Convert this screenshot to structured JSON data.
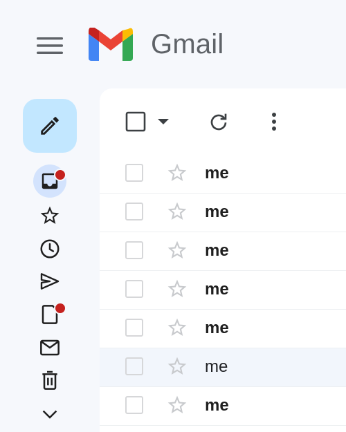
{
  "header": {
    "app_name": "Gmail",
    "menu_icon": "hamburger-menu-icon",
    "logo_icon": "gmail-m-logo-icon"
  },
  "rail": {
    "compose_icon": "pencil-icon",
    "items": [
      {
        "name": "inbox",
        "icon": "inbox-icon",
        "active": true,
        "has_dot": true
      },
      {
        "name": "starred",
        "icon": "star-outline-icon",
        "active": false,
        "has_dot": false
      },
      {
        "name": "snoozed",
        "icon": "clock-icon",
        "active": false,
        "has_dot": false
      },
      {
        "name": "sent",
        "icon": "send-icon",
        "active": false,
        "has_dot": false
      },
      {
        "name": "drafts",
        "icon": "draft-icon",
        "active": false,
        "has_dot": true
      },
      {
        "name": "all-mail",
        "icon": "envelope-icon",
        "active": false,
        "has_dot": false
      },
      {
        "name": "trash",
        "icon": "trash-icon",
        "active": false,
        "has_dot": false
      },
      {
        "name": "more",
        "icon": "chevron-down-icon",
        "active": false,
        "has_dot": false
      }
    ]
  },
  "toolbar": {
    "select_icon": "checkbox-icon",
    "select_menu_icon": "caret-down-icon",
    "refresh_icon": "refresh-icon",
    "more_icon": "vertical-dots-icon"
  },
  "mail_rows": [
    {
      "sender": "me",
      "unread": true
    },
    {
      "sender": "me",
      "unread": true
    },
    {
      "sender": "me",
      "unread": true
    },
    {
      "sender": "me",
      "unread": true
    },
    {
      "sender": "me",
      "unread": true
    },
    {
      "sender": "me",
      "unread": false
    },
    {
      "sender": "me",
      "unread": true
    }
  ],
  "colors": {
    "background": "#f6f8fc",
    "compose_bg": "#c2e7ff",
    "active_pill": "#d3e3fd",
    "notification_dot": "#c5221f",
    "read_row_bg": "#f2f6fc"
  }
}
